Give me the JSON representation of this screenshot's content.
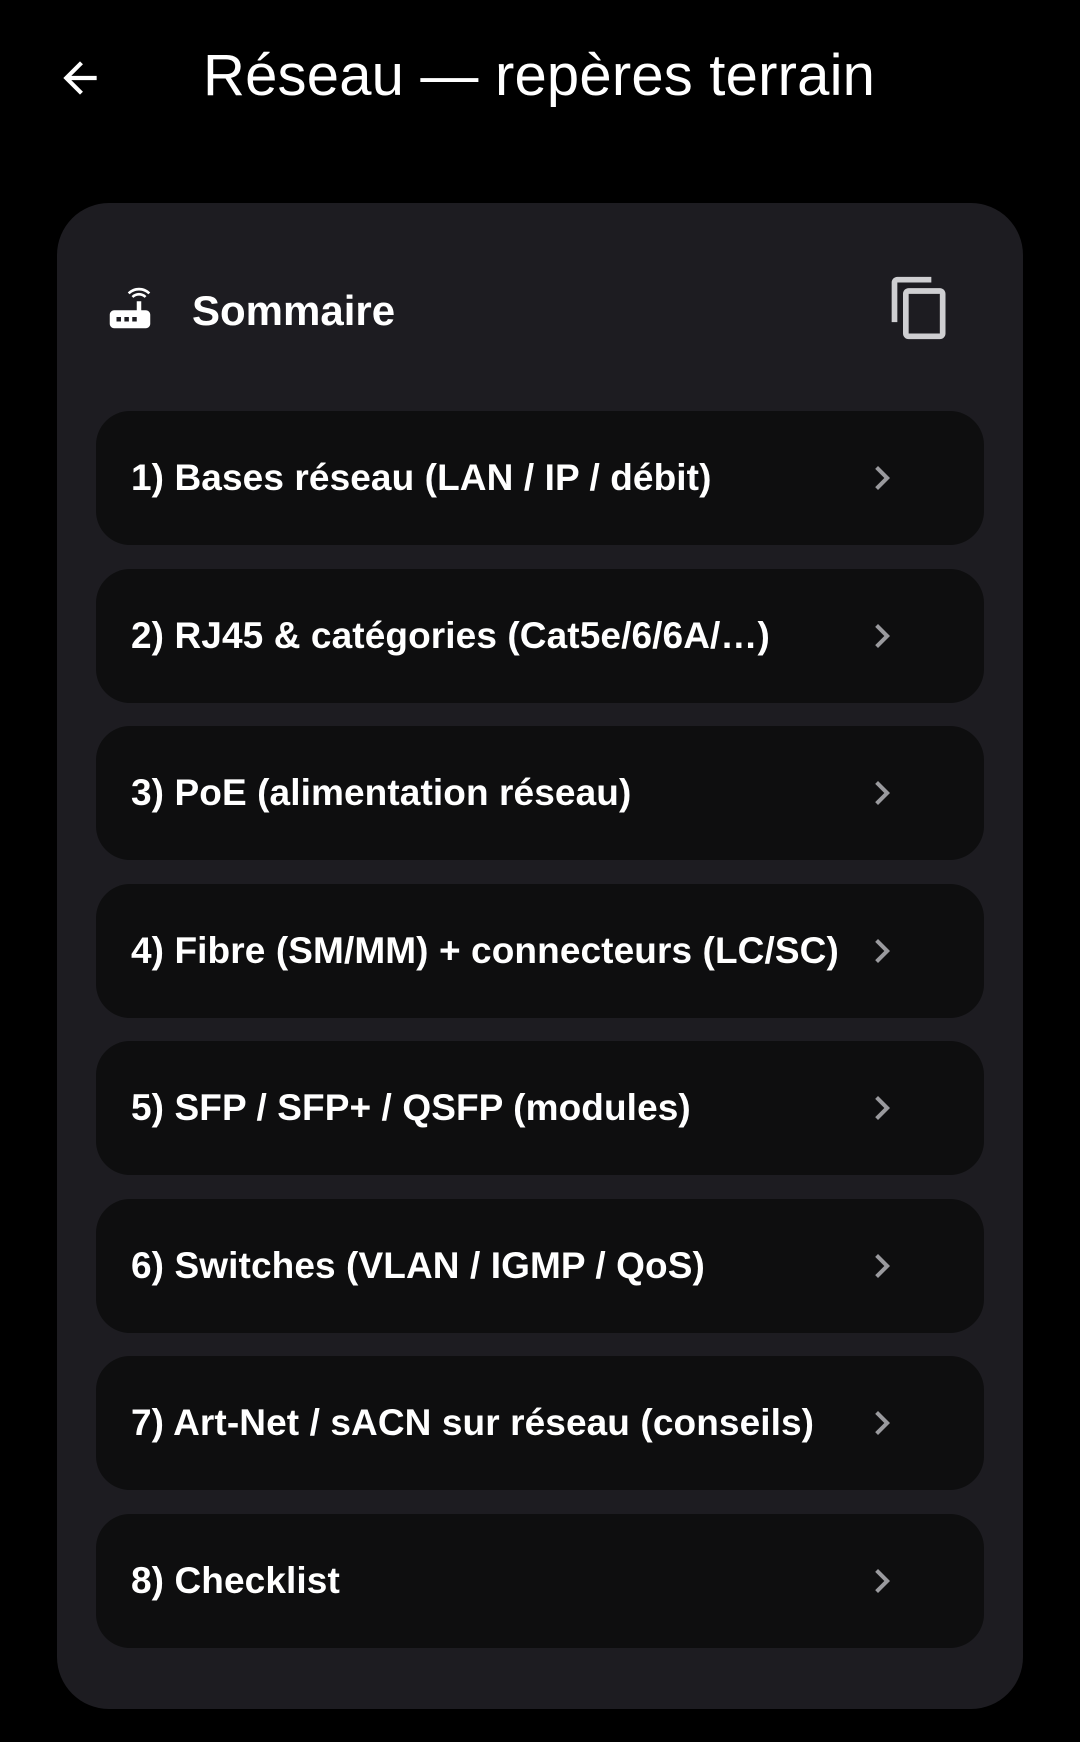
{
  "header": {
    "title": "Réseau — repères terrain",
    "back_icon": "arrow-left-icon"
  },
  "card": {
    "icon": "router-icon",
    "title": "Sommaire",
    "copy_icon": "copy-icon"
  },
  "toc": {
    "items": [
      {
        "label": "1) Bases réseau (LAN / IP / débit)"
      },
      {
        "label": "2) RJ45 & catégories (Cat5e/6/6A/…)"
      },
      {
        "label": "3) PoE (alimentation réseau)"
      },
      {
        "label": "4) Fibre (SM/MM) + connecteurs (LC/SC)"
      },
      {
        "label": "5) SFP / SFP+ / QSFP (modules)"
      },
      {
        "label": "6) Switches (VLAN / IGMP / QoS)"
      },
      {
        "label": "7) Art-Net / sACN sur réseau (conseils)"
      },
      {
        "label": "8) Checklist"
      }
    ],
    "chevron_icon": "chevron-right-icon"
  },
  "colors": {
    "background": "#000000",
    "card": "#1d1c21",
    "item": "#0e0e0f",
    "text": "#ffffff",
    "chevron": "#9a9a9e"
  }
}
